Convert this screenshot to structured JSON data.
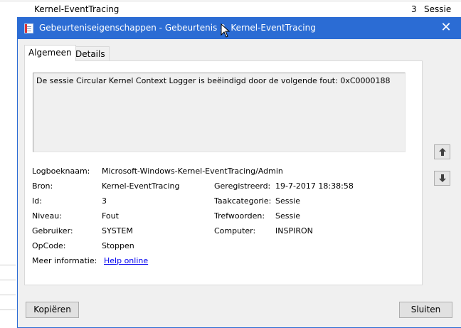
{
  "background": {
    "row": {
      "name": "Kernel-EventTracing",
      "id": "3",
      "category": "Sessie"
    }
  },
  "dialog": {
    "title": "Gebeurteniseigenschappen - Gebeurtenis 3, Kernel-EventTracing",
    "close_glyph": "✕",
    "tabs": [
      {
        "label": "Algemeen"
      },
      {
        "label": "Details"
      }
    ],
    "message": "De sessie Circular Kernel Context Logger is beëindigd door de volgende fout: 0xC0000188",
    "fields": {
      "log_name_label": "Logboeknaam:",
      "log_name_value": "Microsoft-Windows-Kernel-EventTracing/Admin",
      "source_label": "Bron:",
      "source_value": "Kernel-EventTracing",
      "logged_label": "Geregistreerd:",
      "logged_value": "19-7-2017 18:38:58",
      "id_label": "Id:",
      "id_value": "3",
      "task_label": "Taakcategorie:",
      "task_value": "Sessie",
      "level_label": "Niveau:",
      "level_value": "Fout",
      "keywords_label": "Trefwoorden:",
      "keywords_value": "Sessie",
      "user_label": "Gebruiker:",
      "user_value": "SYSTEM",
      "computer_label": "Computer:",
      "computer_value": "INSPIRON",
      "opcode_label": "OpCode:",
      "opcode_value": "Stoppen",
      "more_info_label": "Meer informatie:",
      "more_info_link": "Help online"
    },
    "buttons": {
      "copy": "Kopiëren",
      "close": "Sluiten"
    },
    "colors": {
      "titlebar": "#2b6cd4",
      "link": "#0000ee"
    }
  }
}
